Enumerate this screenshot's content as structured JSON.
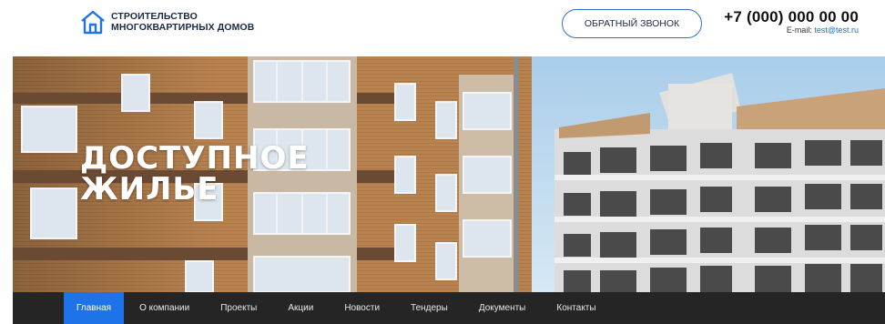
{
  "header": {
    "logo_line1": "СТРОИТЕЛЬСТВО",
    "logo_line2": "МНОГОКВАРТИРНЫХ ДОМОВ",
    "logo_icon": "house-icon",
    "callback_label": "ОБРАТНЫЙ ЗВОНОК",
    "phone": "+7 (000) 000 00 00",
    "email_label": "E-mail:",
    "email": "test@test.ru"
  },
  "hero": {
    "title_line1": "ДОСТУПНОЕ",
    "title_line2": "ЖИЛЬЕ"
  },
  "nav": {
    "items": [
      {
        "label": "Главная",
        "active": true
      },
      {
        "label": "О компании"
      },
      {
        "label": "Проекты"
      },
      {
        "label": "Акции"
      },
      {
        "label": "Новости"
      },
      {
        "label": "Тендеры"
      },
      {
        "label": "Документы"
      },
      {
        "label": "Контакты"
      }
    ]
  },
  "colors": {
    "accent": "#1e73e8",
    "nav_bg": "#252525",
    "logo_text": "#1b2a44",
    "email_link": "#1e6ed6"
  }
}
